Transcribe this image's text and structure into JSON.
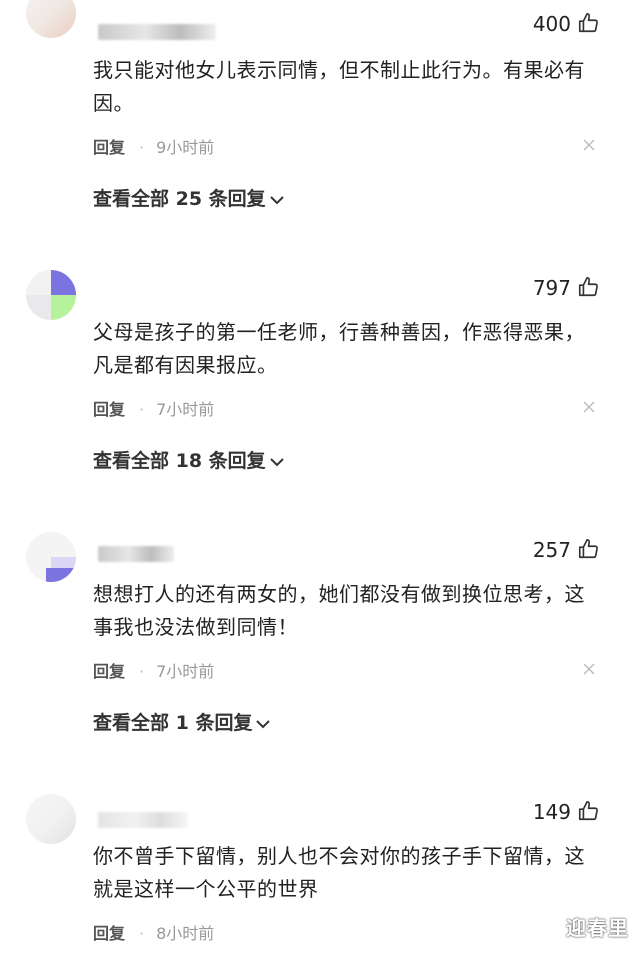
{
  "comments": [
    {
      "likes": "400",
      "text": "我只能对他女儿表示同情，但不制止此行为。有果必有因。",
      "reply_label": "回复",
      "dot": "·",
      "time": "9小时前",
      "view_replies": "查看全部 25 条回复"
    },
    {
      "likes": "797",
      "text": "父母是孩子的第一任老师，行善种善因，作恶得恶果，凡是都有因果报应。",
      "reply_label": "回复",
      "dot": "·",
      "time": "7小时前",
      "view_replies": "查看全部 18 条回复"
    },
    {
      "likes": "257",
      "text": "想想打人的还有两女的，她们都没有做到换位思考，这事我也没法做到同情！",
      "reply_label": "回复",
      "dot": "·",
      "time": "7小时前",
      "view_replies": "查看全部 1 条回复"
    },
    {
      "likes": "149",
      "text": "你不曾手下留情，别人也不会对你的孩子手下留情，这就是这样一个公平的世界",
      "reply_label": "回复",
      "dot": "·",
      "time": "8小时前"
    }
  ],
  "watermark": "迎春里",
  "colors": {
    "text": "#222222",
    "meta": "#999999",
    "avatar_purple": "#7b74e0",
    "avatar_green": "#b6f29a"
  },
  "icons": {
    "like": "thumbs-up-icon",
    "dismiss": "close-icon",
    "expand": "chevron-down-icon"
  }
}
